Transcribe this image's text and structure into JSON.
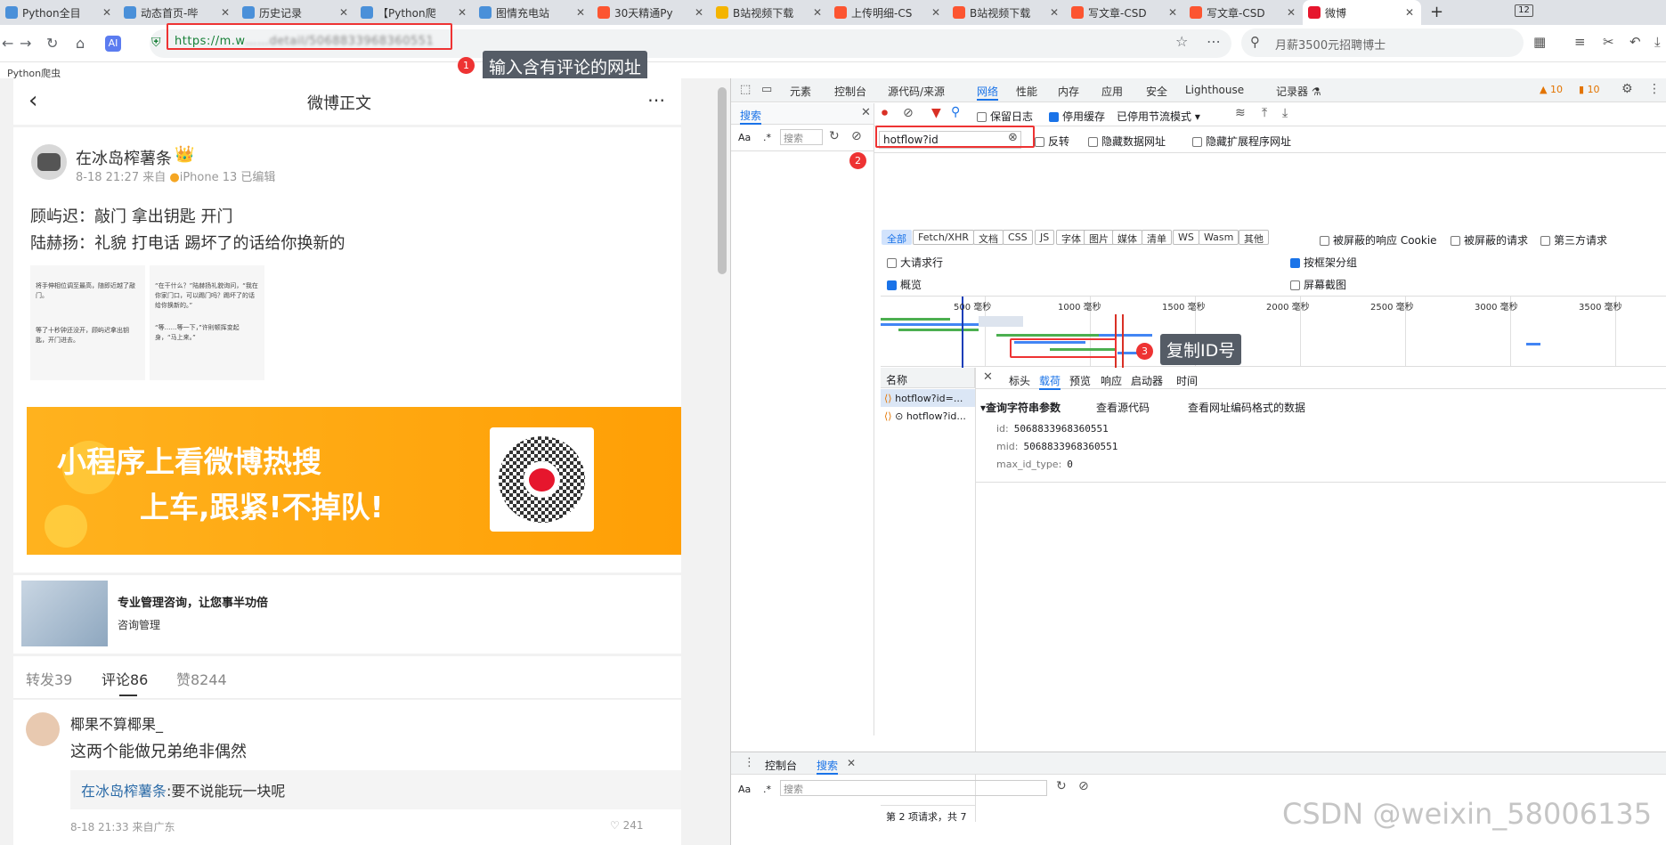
{
  "tabs": [
    {
      "label": "Python全目",
      "color": "#4a90d9"
    },
    {
      "label": "动态首页-哔",
      "color": "#4a90d9"
    },
    {
      "label": "历史记录",
      "color": "#4a90d9"
    },
    {
      "label": "【Python爬",
      "color": "#4a90d9"
    },
    {
      "label": "图情充电站",
      "color": "#4a90d9"
    },
    {
      "label": "30天精通Py",
      "color": "#fc5531"
    },
    {
      "label": "B站视频下载",
      "color": "#f4b400"
    },
    {
      "label": "上传明细-CS",
      "color": "#fc5531"
    },
    {
      "label": "B站视频下载",
      "color": "#fc5531"
    },
    {
      "label": "写文章-CSD",
      "color": "#fc5531"
    },
    {
      "label": "写文章-CSD",
      "color": "#fc5531"
    },
    {
      "label": "微博",
      "color": "#e6162d",
      "active": true
    }
  ],
  "window": {
    "tab_count": "12"
  },
  "address": {
    "url": "https://m.w",
    "url_hidden": "……detail/5068833968360551"
  },
  "search": {
    "placeholder": "月薪3500元招聘博士"
  },
  "bookmarks": {
    "item": "Python爬虫"
  },
  "annotations": {
    "a1": "输入含有评论的网址",
    "a3": "复制ID号",
    "n1": "1",
    "n2": "2",
    "n3": "3"
  },
  "weibo": {
    "header_title": "微博正文",
    "username": "在冰岛榨薯条",
    "meta": "8-18 21:27 来自",
    "device": "iPhone 13 已编辑",
    "text1": "顾屿迟：敲门 拿出钥匙 开门",
    "text2": "陆赫扬：礼貌 打电话 踢坏了的话给你换新的",
    "img1_a": "将手伸相位调至最高，随即近越了敲门。",
    "img1_b": "等了十秒钟还没开，顾屿迟拿出钥匙，开门进去。",
    "img2_a": "“在干什么？”陆赫扬礼貌询问，“我在你家门口，可以踢门吗？踢坏了的话给你换新的。”",
    "img2_b": "“等……等一下，”许則顿挥变起身，“马上来。”",
    "banner_line1": "小程序上看微博热搜",
    "banner_line2": "上车,跟紧!不掉队!",
    "ad_title": "专业管理咨询，让您事半功倍",
    "ad_sub": "咨询管理",
    "stat_repost": "转发39",
    "stat_comment": "评论86",
    "stat_like": "赞8244",
    "comment_user": "椰果不算椰果_",
    "comment_text": "这两个能做兄弟绝非偶然",
    "reply_user": "在冰岛榨薯条",
    "reply_text": ":要不说能玩一块呢",
    "comment_meta": "8-18 21:33 来自广东",
    "comment_likes": "241"
  },
  "devtools": {
    "tabs": [
      "元素",
      "控制台",
      "源代码/来源",
      "网络",
      "性能",
      "内存",
      "应用",
      "安全",
      "Lighthouse",
      "记录器 ⚗"
    ],
    "warn_count": "10",
    "err_count": "10",
    "search_title": "搜索",
    "search_aa": "Aa",
    "search_placeholder": "搜索",
    "filter_value": "hotflow?id",
    "opt_preserve": "保留日志",
    "opt_cache": "停用缓存",
    "opt_throttle": "已停用节流模式",
    "opt_invert": "反转",
    "opt_hide_data": "隐藏数据网址",
    "opt_hide_ext": "隐藏扩展程序网址",
    "filters": [
      "全部",
      "Fetch/XHR",
      "文档",
      "CSS",
      "JS",
      "字体",
      "图片",
      "媒体",
      "清单",
      "WS",
      "Wasm",
      "其他"
    ],
    "opt_blocked_cookie": "被屏蔽的响应 Cookie",
    "opt_blocked_req": "被屏蔽的请求",
    "opt_third": "第三方请求",
    "opt_big_rows": "大请求行",
    "opt_group": "按框架分组",
    "opt_overview": "概览",
    "opt_screenshot": "屏幕截图",
    "ticks": [
      "500 毫秒",
      "1000 毫秒",
      "1500 毫秒",
      "2000 毫秒",
      "2500 毫秒",
      "3000 毫秒",
      "3500 毫秒"
    ],
    "col_name": "名称",
    "req1": "hotflow?id=...",
    "req2": "hotflow?id...",
    "detail_tabs": [
      "标头",
      "载荷",
      "预览",
      "响应",
      "启动器",
      "时间"
    ],
    "section": "▾查询字符串参数",
    "view_source": "查看源代码",
    "view_encoded": "查看网址编码格式的数据",
    "params": [
      {
        "k": "id:",
        "v": "5068833968360551"
      },
      {
        "k": "mid:",
        "v": "5068833968360551"
      },
      {
        "k": "max_id_type:",
        "v": "0"
      }
    ],
    "status": "第 2 项请求，共 7",
    "drawer_console": "控制台",
    "drawer_search": "搜索",
    "drawer_placeholder": "搜索"
  },
  "watermark": "CSDN @weixin_58006135"
}
